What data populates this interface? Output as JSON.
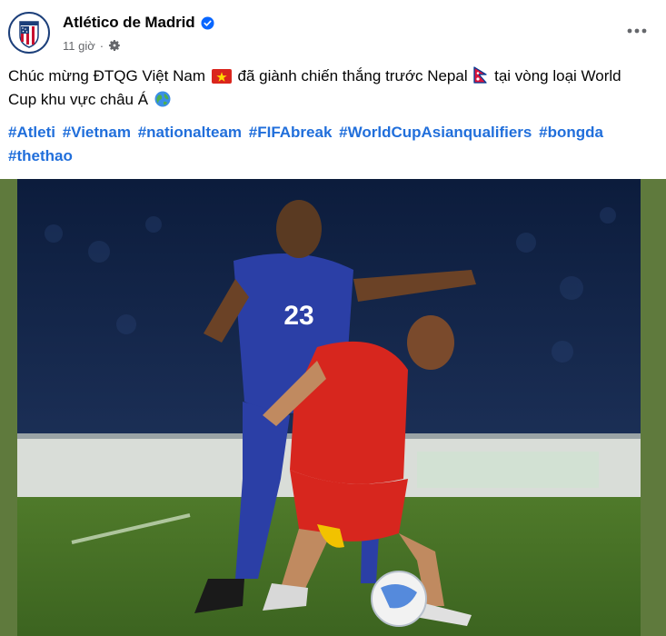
{
  "post": {
    "author": "Atlético de Madrid",
    "timestamp": "11 giờ",
    "meta_separator": "·",
    "text_part1": "Chúc mừng ĐTQG Việt Nam",
    "text_part2": "đã giành chiến thắng trước Nepal",
    "text_part3": "tại vòng loại World Cup khu vực châu Á",
    "hashtags": [
      "#Atleti",
      "#Vietnam",
      "#nationalteam",
      "#FIFAbreak",
      "#WorldCupAsianqualifiers",
      "#bongda",
      "#thethao"
    ],
    "photo_jersey_number": "23"
  },
  "icons": {
    "verified": "verified-badge-icon",
    "audience": "gear-icon",
    "more": "more-options-icon",
    "vn_flag": "vietnam-flag-icon",
    "np_flag": "nepal-flag-icon",
    "globe": "globe-icon"
  },
  "colors": {
    "name": "#050505",
    "meta": "#65676b",
    "hashtag": "#216fdb",
    "verified": "#0866ff",
    "photo_border": "#5f7a3d"
  }
}
